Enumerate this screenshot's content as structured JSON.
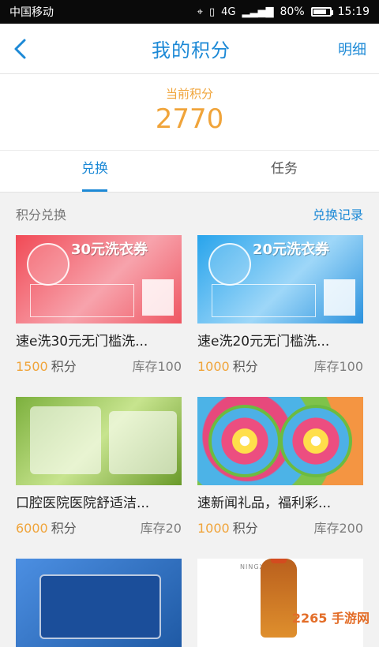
{
  "status_bar": {
    "carrier": "中国移动",
    "network": "4G",
    "battery": "80%",
    "battery_level": 0.8,
    "time": "15:19"
  },
  "header": {
    "title": "我的积分",
    "detail_label": "明细"
  },
  "points": {
    "label": "当前积分",
    "value": "2770"
  },
  "tabs": [
    {
      "label": "兑换",
      "active": true
    },
    {
      "label": "任务",
      "active": false
    }
  ],
  "section": {
    "title": "积分兑换",
    "record_label": "兑换记录"
  },
  "items": [
    {
      "name": "速e洗30元无门槛洗...",
      "price": "1500",
      "unit": "积分",
      "stock": "库存100",
      "image_text": "30元洗衣券"
    },
    {
      "name": "速e洗20元无门槛洗...",
      "price": "1000",
      "unit": "积分",
      "stock": "库存100",
      "image_text": "20元洗衣券"
    },
    {
      "name": "口腔医院医院舒适洁...",
      "price": "6000",
      "unit": "积分",
      "stock": "库存20"
    },
    {
      "name": "速新闻礼品，福利彩...",
      "price": "1000",
      "unit": "积分",
      "stock": "库存200"
    }
  ],
  "next_item": {
    "image_text": "NINGXIAHONG"
  },
  "watermark": "2265 手游网",
  "colors": {
    "accent": "#1c89d6",
    "points": "#f0a43a",
    "status_bar": "#0a0a0a"
  },
  "icons": {
    "back": "back-arrow-icon",
    "location": "location-icon",
    "vibrate": "vibrate-icon",
    "signal": "signal-icon",
    "battery": "battery-icon"
  }
}
